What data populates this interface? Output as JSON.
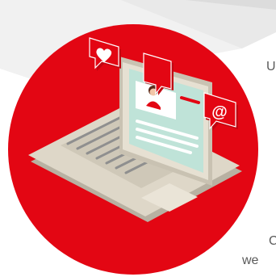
{
  "colors": {
    "accent": "#e30613",
    "screen": "#bfe3d8",
    "laptop_body": "#ded7c8",
    "keys": "#8f8f8f",
    "edge_text": "#5a5a5a",
    "paper": "#ededed"
  },
  "icons": [
    "heart-icon",
    "user-avatar-icon",
    "at-sign-icon",
    "laptop-icon"
  ],
  "edge_text": {
    "line1": "U",
    "line2": "C",
    "line3": "we"
  }
}
